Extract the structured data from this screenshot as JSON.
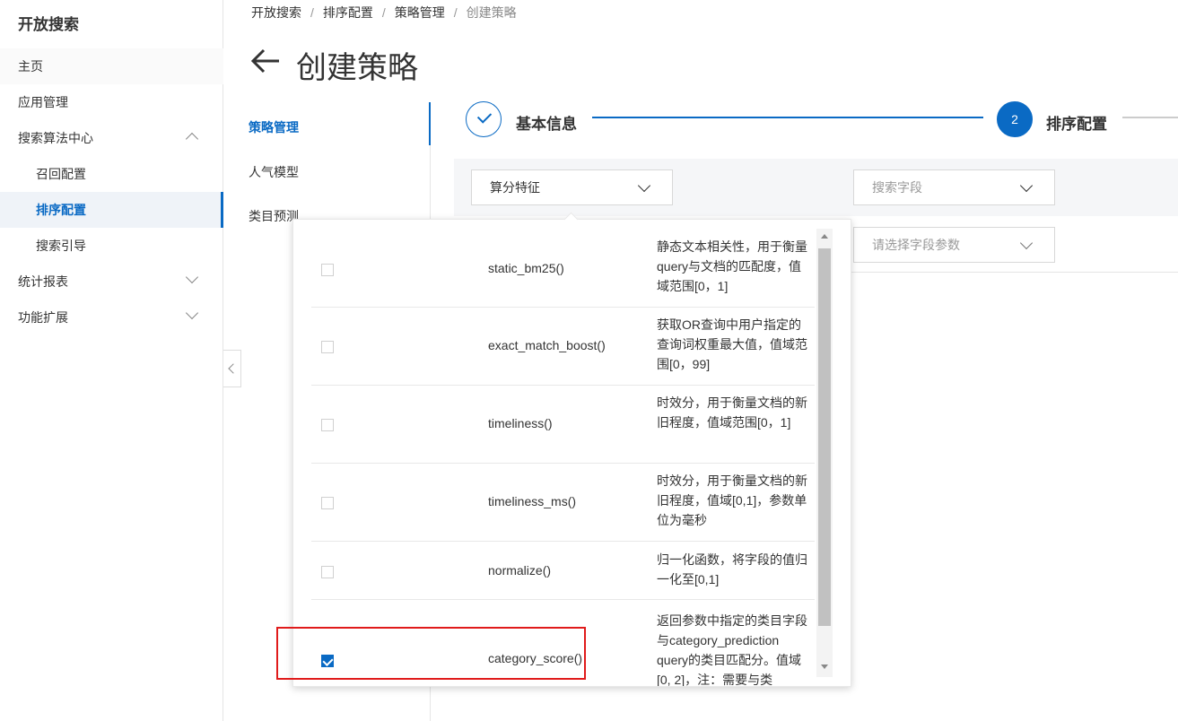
{
  "sidebar": {
    "brand": "开放搜索",
    "items": [
      {
        "label": "主页"
      },
      {
        "label": "应用管理"
      },
      {
        "label": "搜索算法中心"
      },
      {
        "label": "召回配置"
      },
      {
        "label": "排序配置"
      },
      {
        "label": "搜索引导"
      },
      {
        "label": "统计报表"
      },
      {
        "label": "功能扩展"
      }
    ]
  },
  "breadcrumb": [
    "开放搜索",
    "排序配置",
    "策略管理",
    "创建策略"
  ],
  "breadcrumb_sep": "/",
  "title": "创建策略",
  "subnav": [
    "策略管理",
    "人气模型",
    "类目预测"
  ],
  "steps": [
    {
      "number": "1",
      "label": "基本信息",
      "status": "done"
    },
    {
      "number": "2",
      "label": "排序配置",
      "status": "active"
    }
  ],
  "form": {
    "feature_select": "算分特征",
    "field_select_placeholder": "搜索字段",
    "param_select_placeholder": "请选择字段参数"
  },
  "dropdown": {
    "rows": [
      {
        "fn": "static_bm25()",
        "desc": "静态文本相关性，用于衡量query与文档的匹配度，值域范围[0，1]",
        "checked": false
      },
      {
        "fn": "exact_match_boost()",
        "desc": "获取OR查询中用户指定的查询词权重最大值，值域范围[0，99]",
        "checked": false
      },
      {
        "fn": "timeliness()",
        "desc": "时效分，用于衡量文档的新旧程度，值域范围[0，1]",
        "checked": false
      },
      {
        "fn": "timeliness_ms()",
        "desc": "时效分，用于衡量文档的新旧程度，值域[0,1]，参数单位为毫秒",
        "checked": false
      },
      {
        "fn": "normalize()",
        "desc": "归一化函数，将字段的值归一化至[0,1]",
        "checked": false
      },
      {
        "fn": "category_score()",
        "desc": "返回参数中指定的类目字段与category_prediction query的类目匹配分。值域[0, 2]，注：需要与类",
        "checked": true
      }
    ]
  },
  "colors": {
    "accent": "#0a6ac4",
    "highlight": "#e01b1b"
  }
}
